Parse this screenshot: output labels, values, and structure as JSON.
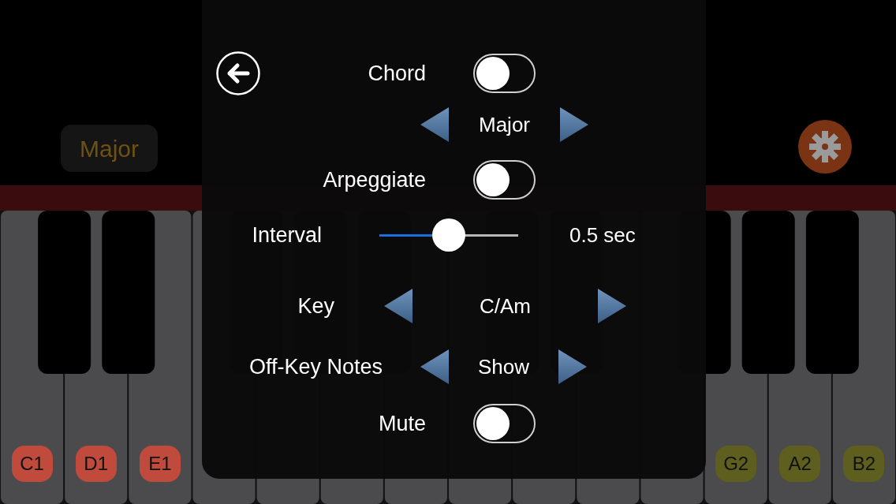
{
  "background": {
    "scale_badge": "Major",
    "piano": {
      "left_keys": [
        {
          "label": "C1",
          "color": "#c04a3c"
        },
        {
          "label": "D1",
          "color": "#c04a3c"
        },
        {
          "label": "E1",
          "color": "#c04a3c"
        }
      ],
      "right_keys": [
        {
          "label": "G2",
          "color": "#5e5e1e"
        },
        {
          "label": "A2",
          "color": "#5e5e1e"
        },
        {
          "label": "B2",
          "color": "#5e5e1e"
        }
      ]
    }
  },
  "settings": {
    "rows": [
      {
        "kind": "toggle",
        "label": "Chord",
        "on": false
      },
      {
        "kind": "selector",
        "value": "Major"
      },
      {
        "kind": "toggle",
        "label": "Arpeggiate",
        "on": false
      },
      {
        "kind": "slider",
        "label": "Interval",
        "level": 0.5,
        "reading": "0.5 sec"
      },
      {
        "kind": "selector",
        "label": "Key",
        "value": "C/Am"
      },
      {
        "kind": "selector",
        "label": "Off-Key Notes",
        "value": "Show"
      },
      {
        "kind": "toggle",
        "label": "Mute",
        "on": false
      }
    ]
  }
}
